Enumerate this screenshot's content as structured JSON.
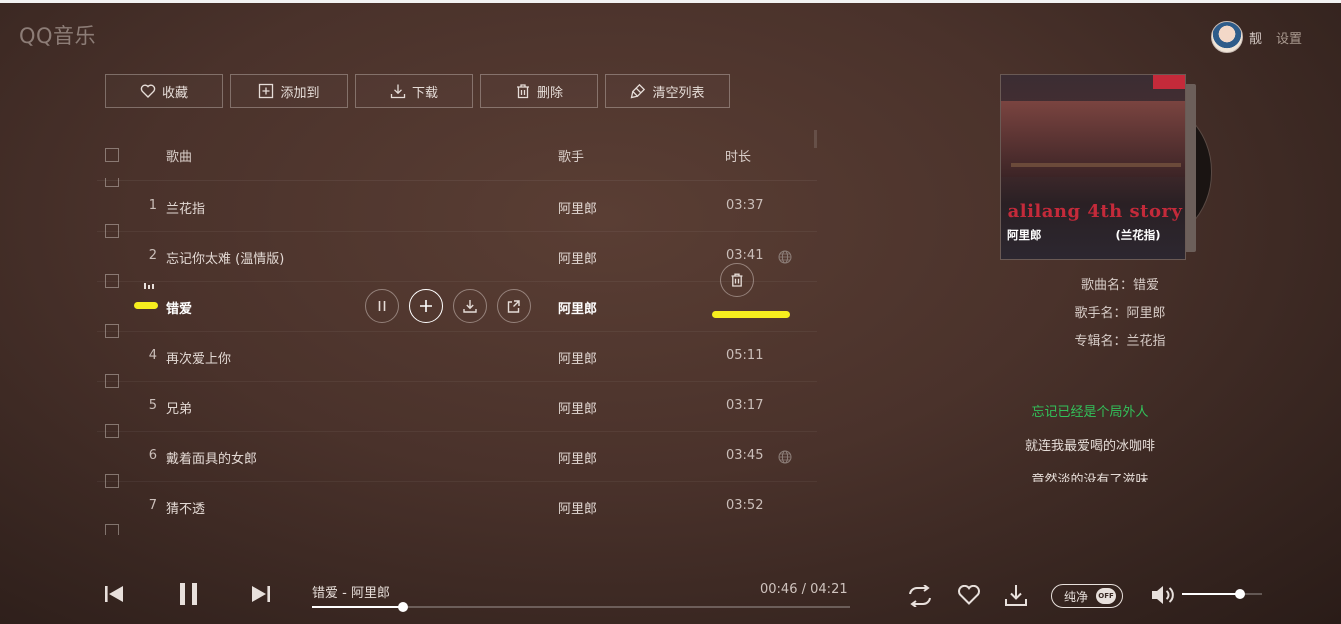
{
  "app": {
    "logo": "QQ音乐",
    "username": "靓",
    "settings": "设置"
  },
  "toolbar": {
    "favorite": "收藏",
    "add_to": "添加到",
    "download": "下载",
    "delete": "删除",
    "clear_list": "清空列表"
  },
  "list": {
    "headers": {
      "song": "歌曲",
      "singer": "歌手",
      "duration": "时长"
    },
    "rows": [
      {
        "num": "1",
        "title": "兰花指",
        "singer": "阿里郎",
        "duration": "03:37",
        "globe": false
      },
      {
        "num": "2",
        "title": "忘记你太难 (温情版)",
        "singer": "阿里郎",
        "duration": "03:41",
        "globe": true
      },
      {
        "num": "",
        "title": "错爱",
        "singer": "阿里郎",
        "duration": "",
        "globe": false,
        "playing": true
      },
      {
        "num": "4",
        "title": "再次爱上你",
        "singer": "阿里郎",
        "duration": "05:11",
        "globe": false
      },
      {
        "num": "5",
        "title": "兄弟",
        "singer": "阿里郎",
        "duration": "03:17",
        "globe": false
      },
      {
        "num": "6",
        "title": "戴着面具的女郎",
        "singer": "阿里郎",
        "duration": "03:45",
        "globe": true
      },
      {
        "num": "7",
        "title": "猜不透",
        "singer": "阿里郎",
        "duration": "03:52",
        "globe": false
      }
    ],
    "row_action_icons": [
      "pause-icon",
      "plus-icon",
      "download-icon",
      "share-icon",
      "trash-icon"
    ]
  },
  "album": {
    "cover_title_en": "alilang 4th story",
    "cover_title_cn_artist": "阿里郎",
    "cover_title_cn_album": "(兰花指)",
    "song_name": "歌曲名：错爱",
    "singer_name": "歌手名：阿里郎",
    "album_name": "专辑名：兰花指"
  },
  "lyrics": [
    {
      "text": "忘记已经是个局外人",
      "current": true
    },
    {
      "text": "就连我最爱喝的冰咖啡",
      "current": false
    },
    {
      "text": "竟然淡的没有了滋味",
      "current": false
    }
  ],
  "player": {
    "now_playing": "错爱 - 阿里郎",
    "elapsed": "00:46",
    "separator": "/",
    "total": "04:21",
    "progress_fraction": 0.17,
    "pure_mode_label": "纯净",
    "pure_mode_state": "OFF",
    "volume_fraction": 0.73
  },
  "colors": {
    "accent_lyric": "#32c15a",
    "highlight": "#f6ee1e"
  }
}
